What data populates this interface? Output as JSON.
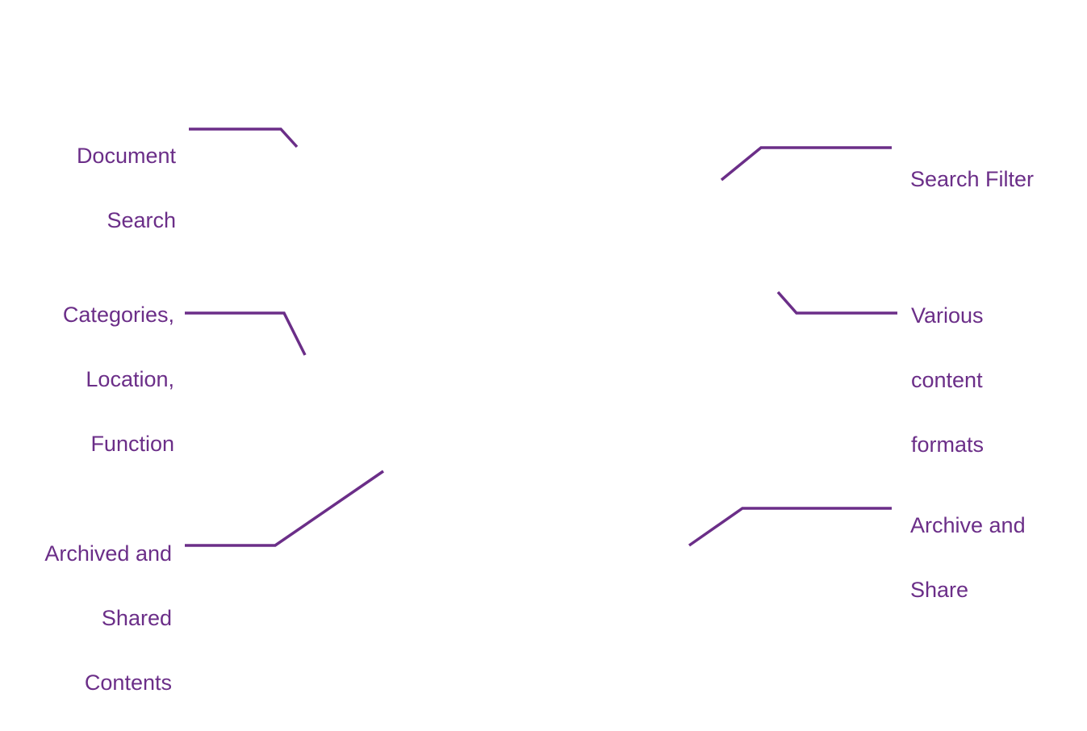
{
  "diagram": {
    "accent_color": "#6B2E88",
    "callouts": [
      {
        "id": "document-search",
        "side": "left",
        "lines": [
          "Document",
          "Search"
        ]
      },
      {
        "id": "categories-location-function",
        "side": "left",
        "lines": [
          "Categories,",
          "Location,",
          "Function"
        ]
      },
      {
        "id": "archived-shared-contents",
        "side": "left",
        "lines": [
          "Archived and",
          "Shared",
          "Contents"
        ]
      },
      {
        "id": "search-filter",
        "side": "right",
        "lines": [
          "Search Filter"
        ]
      },
      {
        "id": "various-content-formats",
        "side": "right",
        "lines": [
          "Various",
          "content",
          "formats"
        ]
      },
      {
        "id": "archive-and-share",
        "side": "right",
        "lines": [
          "Archive and",
          "Share"
        ]
      }
    ]
  }
}
